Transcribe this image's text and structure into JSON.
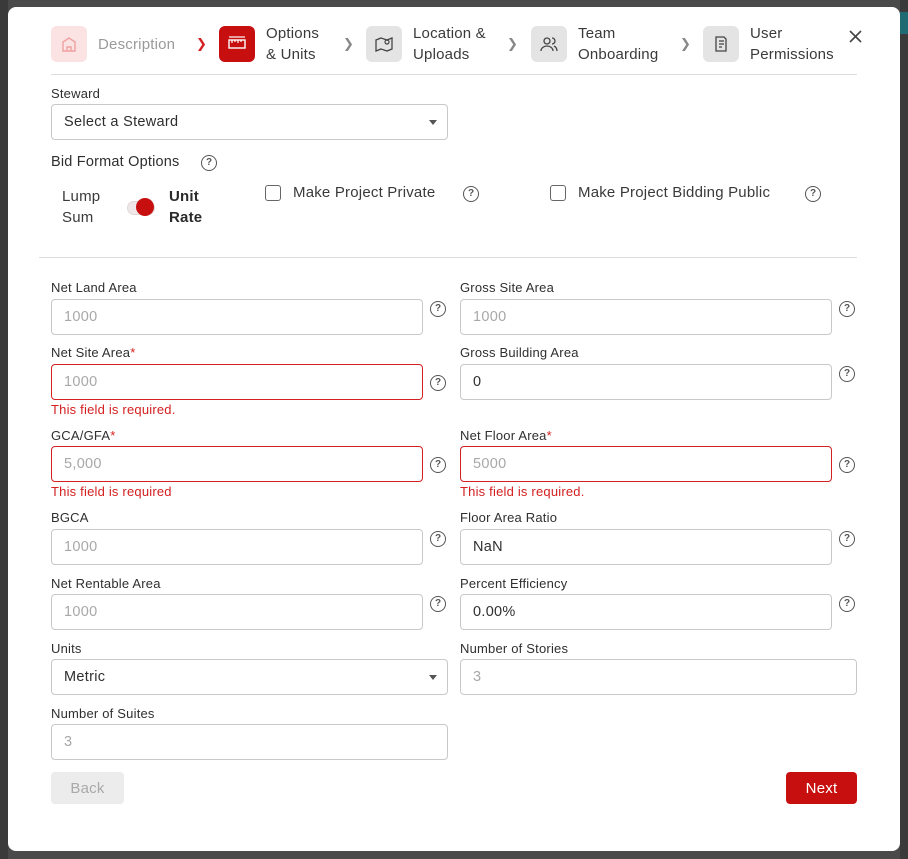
{
  "stepper": {
    "steps": [
      {
        "label": "Description"
      },
      {
        "label": "Options & Units"
      },
      {
        "label": "Location & Uploads"
      },
      {
        "label": "Team Onboarding"
      },
      {
        "label": "User Permissions"
      }
    ]
  },
  "steward": {
    "label": "Steward",
    "placeholder": "Select a Steward"
  },
  "bid_format": {
    "label": "Bid Format Options",
    "toggle_left": "Lump Sum",
    "toggle_right": "Unit Rate",
    "private_label": "Make Project Private",
    "public_label": "Make Project Bidding Public"
  },
  "fields": {
    "net_land_area": {
      "label": "Net Land Area",
      "placeholder": "1000"
    },
    "gross_site_area": {
      "label": "Gross Site Area",
      "placeholder": "1000"
    },
    "net_site_area": {
      "label": "Net Site Area",
      "required": "*",
      "placeholder": "1000",
      "error": "This field is required."
    },
    "gross_building_area": {
      "label": "Gross Building Area",
      "value": "0"
    },
    "gca_gfa": {
      "label": "GCA/GFA",
      "required": "*",
      "placeholder": "5,000",
      "error": "This field is required"
    },
    "net_floor_area": {
      "label": "Net Floor Area",
      "required": "*",
      "placeholder": "5000",
      "error": "This field is required."
    },
    "bgca": {
      "label": "BGCA",
      "placeholder": "1000"
    },
    "floor_area_ratio": {
      "label": "Floor Area Ratio",
      "value": "NaN"
    },
    "net_rentable_area": {
      "label": "Net Rentable Area",
      "placeholder": "1000"
    },
    "percent_efficiency": {
      "label": "Percent Efficiency",
      "value": "0.00%"
    },
    "units": {
      "label": "Units",
      "value": "Metric"
    },
    "number_of_stories": {
      "label": "Number of Stories",
      "placeholder": "3"
    },
    "number_of_suites": {
      "label": "Number of Suites",
      "placeholder": "3"
    }
  },
  "actions": {
    "back": "Back",
    "next": "Next"
  },
  "colors": {
    "accent": "#c80f0f",
    "error": "#d42020"
  }
}
